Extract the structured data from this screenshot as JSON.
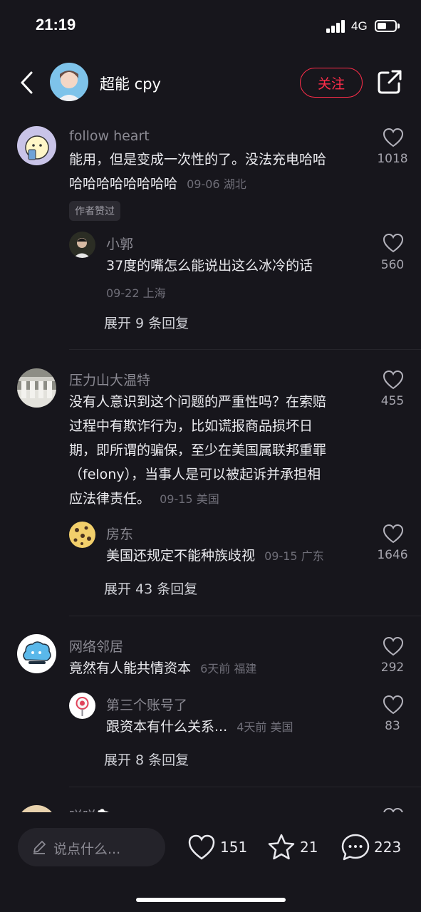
{
  "status": {
    "time": "21:19",
    "network": "4G"
  },
  "header": {
    "name": "超能 cpy",
    "follow_label": "关注"
  },
  "comments": [
    {
      "user": "follow heart",
      "text_line1": "能用，但是变成一次性的了。没法充电哈哈",
      "text_line2": "哈哈哈哈哈哈哈哈",
      "meta": "09-06 湖北",
      "badge": "作者赞过",
      "likes": "1018",
      "reply": {
        "user": "小郭",
        "text": "37度的嘴怎么能说出这么冰冷的话",
        "meta": "09-22 上海",
        "likes": "560"
      },
      "expand": "展开 9 条回复"
    },
    {
      "user": "压力山大温特",
      "text_lines": [
        "没有人意识到这个问题的严重性吗？在索赔",
        "过程中有欺诈行为，比如谎报商品损坏日",
        "期，即所谓的骗保，至少在美国属联邦重罪",
        "（felony），当事人是可以被起诉并承担相",
        "应法律责任。"
      ],
      "meta": "09-15 美国",
      "likes": "455",
      "reply": {
        "user": "房东",
        "text": "美国还规定不能种族歧视",
        "meta": "09-15 广东",
        "likes": "1646"
      },
      "expand": "展开 43 条回复"
    },
    {
      "user": "网络邻居",
      "text": "竟然有人能共情资本",
      "meta": "6天前 福建",
      "likes": "292",
      "reply": {
        "user": "第三个账号了",
        "text": "跟资本有什么关系...",
        "meta": "4天前 美国",
        "likes": "83"
      },
      "expand": "展开 8 条回复"
    },
    {
      "user": "咩咩🐑"
    }
  ],
  "bottom": {
    "placeholder": "说点什么...",
    "likes": "151",
    "favorites": "21",
    "comments": "223"
  }
}
